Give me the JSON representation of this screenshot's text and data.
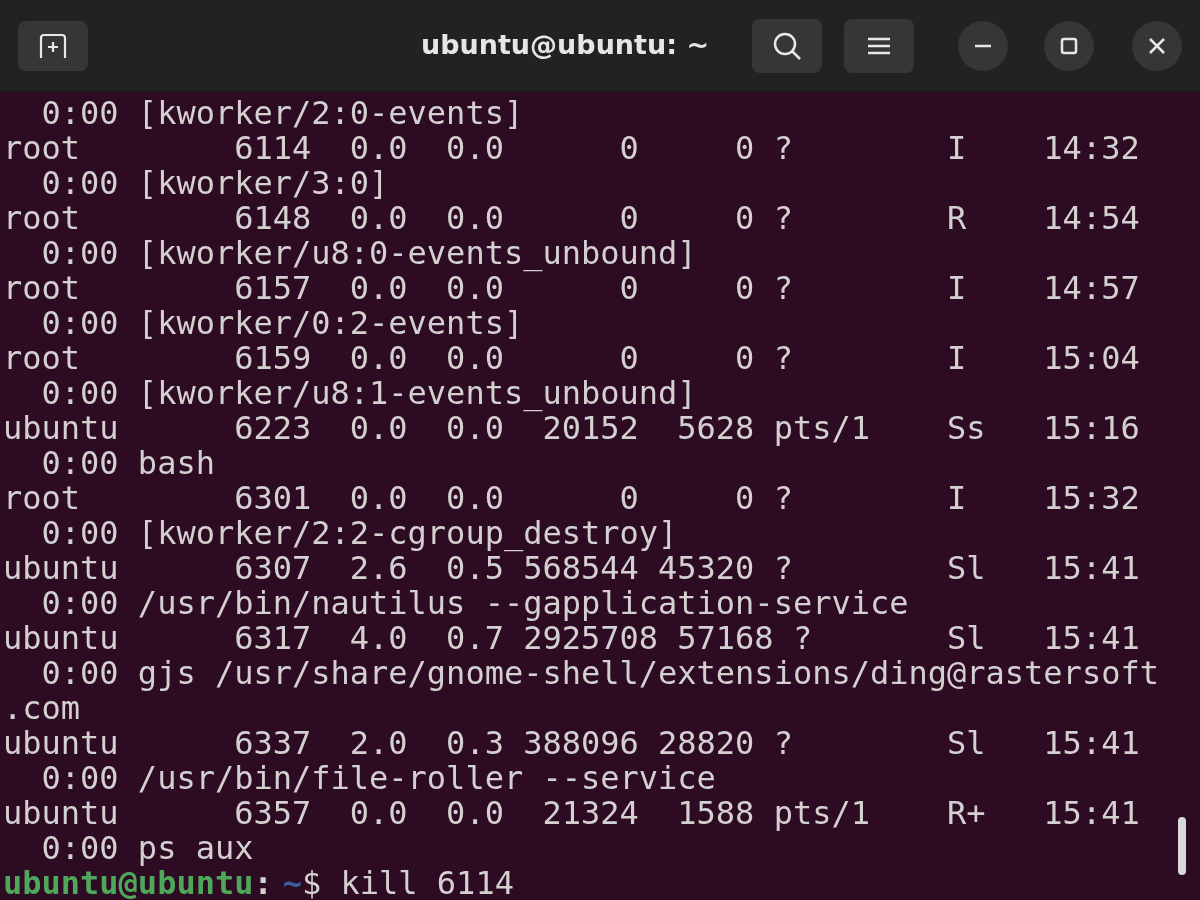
{
  "window": {
    "title": "ubuntu@ubuntu: ~"
  },
  "terminal": {
    "lines": [
      "  0:00 [kworker/2:0-events]",
      "root        6114  0.0  0.0      0     0 ?        I    14:32",
      "  0:00 [kworker/3:0]",
      "root        6148  0.0  0.0      0     0 ?        R    14:54",
      "  0:00 [kworker/u8:0-events_unbound]",
      "root        6157  0.0  0.0      0     0 ?        I    14:57",
      "  0:00 [kworker/0:2-events]",
      "root        6159  0.0  0.0      0     0 ?        I    15:04",
      "  0:00 [kworker/u8:1-events_unbound]",
      "ubuntu      6223  0.0  0.0  20152  5628 pts/1    Ss   15:16",
      "  0:00 bash",
      "root        6301  0.0  0.0      0     0 ?        I    15:32",
      "  0:00 [kworker/2:2-cgroup_destroy]",
      "ubuntu      6307  2.6  0.5 568544 45320 ?        Sl   15:41",
      "  0:00 /usr/bin/nautilus --gapplication-service",
      "ubuntu      6317  4.0  0.7 2925708 57168 ?       Sl   15:41",
      "  0:00 gjs /usr/share/gnome-shell/extensions/ding@rastersoft",
      ".com",
      "ubuntu      6337  2.0  0.3 388096 28820 ?        Sl   15:41",
      "  0:00 /usr/bin/file-roller --service",
      "ubuntu      6357  0.0  0.0  21324  1588 pts/1    R+   15:41",
      "  0:00 ps aux"
    ],
    "prompt": {
      "user_host": "ubuntu@ubuntu",
      "separator": ":",
      "path": "~",
      "command": "$ kill 6114"
    }
  }
}
